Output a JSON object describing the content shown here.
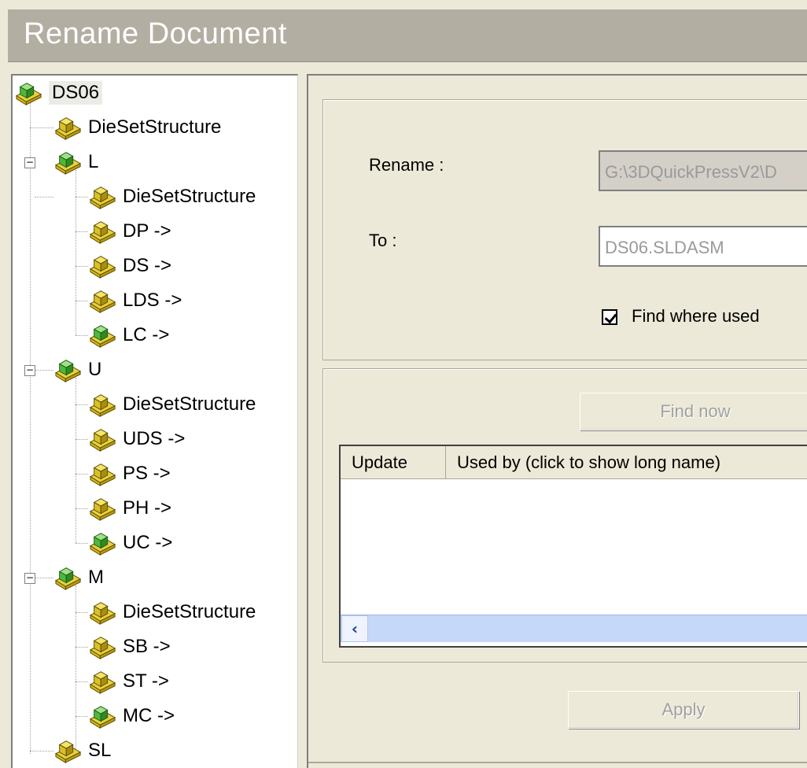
{
  "window": {
    "title": "Rename Document"
  },
  "tree": {
    "root": "DS06",
    "items": [
      {
        "label": "DieSetStructure",
        "icon": "yellow-assembly-icon"
      },
      {
        "label": "L",
        "icon": "green-assembly-icon"
      },
      {
        "label": "DieSetStructure",
        "icon": "yellow-assembly-icon"
      },
      {
        "label": "DP ->",
        "icon": "yellow-assembly-icon"
      },
      {
        "label": "DS ->",
        "icon": "yellow-assembly-icon"
      },
      {
        "label": "LDS ->",
        "icon": "yellow-assembly-icon"
      },
      {
        "label": "LC ->",
        "icon": "green-assembly-icon"
      },
      {
        "label": "U",
        "icon": "green-assembly-icon"
      },
      {
        "label": "DieSetStructure",
        "icon": "yellow-assembly-icon"
      },
      {
        "label": "UDS ->",
        "icon": "yellow-assembly-icon"
      },
      {
        "label": "PS ->",
        "icon": "yellow-assembly-icon"
      },
      {
        "label": "PH ->",
        "icon": "yellow-assembly-icon"
      },
      {
        "label": "UC ->",
        "icon": "green-assembly-icon"
      },
      {
        "label": "M",
        "icon": "green-assembly-icon"
      },
      {
        "label": "DieSetStructure",
        "icon": "yellow-assembly-icon"
      },
      {
        "label": "SB ->",
        "icon": "yellow-assembly-icon"
      },
      {
        "label": "ST ->",
        "icon": "yellow-assembly-icon"
      },
      {
        "label": "MC ->",
        "icon": "green-assembly-icon"
      },
      {
        "label": "SL",
        "icon": "yellow-assembly-icon"
      }
    ]
  },
  "form": {
    "rename_label": "Rename :",
    "rename_value": "G:\\3DQuickPressV2\\D",
    "to_label": "To :",
    "to_value": "DS06.SLDASM",
    "find_where_used_label": "Find where used",
    "find_where_used_checked": true
  },
  "find_now_button": "Find now",
  "list": {
    "columns": [
      "Update",
      "Used by (click to show long name)"
    ]
  },
  "apply_button": "Apply",
  "colors": {
    "accent": "#c6d8f9",
    "title_bar": "#b3aea2"
  }
}
